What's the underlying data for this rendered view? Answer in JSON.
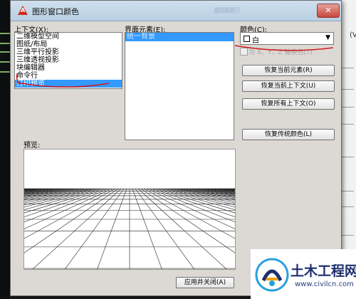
{
  "dialog": {
    "title": "图形窗口颜色",
    "title_blurred": "窗口名称"
  },
  "context": {
    "label": "上下文(X):",
    "items": [
      "二维模型空间",
      "图纸/布局",
      "三维平行投影",
      "三维透视投影",
      "块编辑器",
      "命令行",
      "打印预览"
    ],
    "selected_index": 6
  },
  "elements": {
    "label": "界面元素(E):",
    "items": [
      "统一背景"
    ],
    "selected_index": 0
  },
  "color": {
    "label": "颜色(C):",
    "value": "白",
    "swatch": "#ffffff",
    "tint_label": "为 X、Y、Z 轴染色(T)",
    "tint_checked": false
  },
  "buttons": {
    "restore_element": "恢复当前元素(R)",
    "restore_context": "恢复当前上下文(U)",
    "restore_all_contexts": "恢复所有上下文(O)",
    "restore_classic": "恢复传统颜色(L)",
    "apply_close": "应用并关闭(A)"
  },
  "preview": {
    "label": "预览:"
  },
  "annotation_color": "#d11a1a",
  "selection_color": "#3399ff",
  "watermark": {
    "title": "土木工程网",
    "url": "www.civilcn.com"
  }
}
